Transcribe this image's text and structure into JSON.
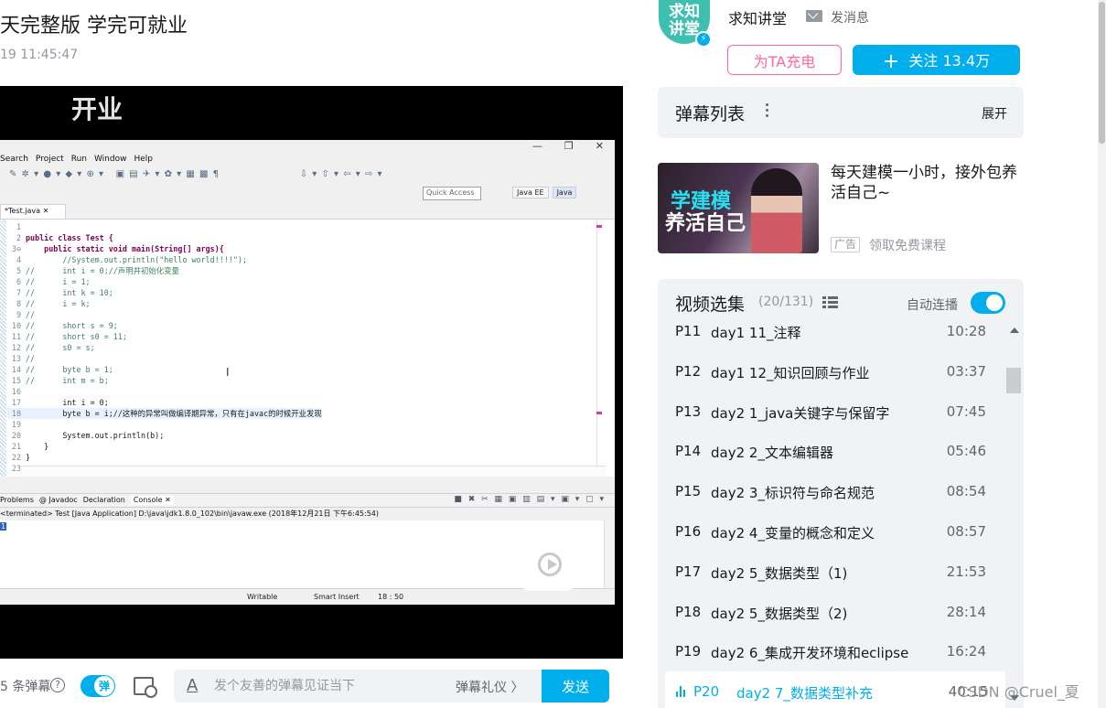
{
  "video": {
    "title": "天完整版 学完可就业",
    "date": "19 11:45:47",
    "caption": "开业"
  },
  "ide": {
    "window_buttons": [
      "—",
      "❐",
      "✕"
    ],
    "menus": [
      "Search",
      "Project",
      "Run",
      "Window",
      "Help"
    ],
    "quick_access": "Quick Access",
    "perspectives": [
      "Java EE",
      "Java"
    ],
    "editor_tab": "*Test.java ✕",
    "code": [
      {
        "n": "1",
        "t": "",
        "k": ""
      },
      {
        "n": "2",
        "t": "public class Test {",
        "k": "kw"
      },
      {
        "n": "3⊖",
        "t": "    public static void main(String[] args){",
        "k": "kw"
      },
      {
        "n": "4",
        "t": "        //System.out.println(\"hello world!!!!\");",
        "k": "cm"
      },
      {
        "n": "5",
        "t": "//      int i = 0;//声明并初始化变量",
        "k": "cm"
      },
      {
        "n": "6",
        "t": "//      i = 1;",
        "k": "cm"
      },
      {
        "n": "7",
        "t": "//      int k = 10;",
        "k": "cm"
      },
      {
        "n": "8",
        "t": "//      i = k;",
        "k": "cm"
      },
      {
        "n": "9",
        "t": "//",
        "k": "cm"
      },
      {
        "n": "10",
        "t": "//      short s = 9;",
        "k": "cm"
      },
      {
        "n": "11",
        "t": "//      short s0 = 11;",
        "k": "cm"
      },
      {
        "n": "12",
        "t": "//      s0 = s;",
        "k": "cm"
      },
      {
        "n": "13",
        "t": "//",
        "k": "cm"
      },
      {
        "n": "14",
        "t": "//      byte b = 1;",
        "k": "cm"
      },
      {
        "n": "15",
        "t": "//      int m = b;",
        "k": "cm"
      },
      {
        "n": "16",
        "t": "",
        "k": ""
      },
      {
        "n": "17",
        "t": "        int i = 0;",
        "k": ""
      },
      {
        "n": "18",
        "t": "        byte b = i;//这种的异常叫做编译期异常，只有在javac的时候开业发现",
        "k": "hl"
      },
      {
        "n": "19",
        "t": "",
        "k": ""
      },
      {
        "n": "20",
        "t": "        System.out.println(b);",
        "k": ""
      },
      {
        "n": "21",
        "t": "    }",
        "k": ""
      },
      {
        "n": "22",
        "t": "}",
        "k": ""
      },
      {
        "n": "23",
        "t": "",
        "k": ""
      }
    ],
    "console_tabs": [
      "Problems",
      "@ Javadoc",
      "Declaration",
      "Console ✕"
    ],
    "console_status": "<terminated> Test [Java Application] D:\\java\\jdk1.8.0_102\\bin\\javaw.exe (2018年12月21日 下午6:45:54)",
    "console_output": "1",
    "status_writable": "Writable",
    "status_insert": "Smart Insert",
    "status_position": "18 : 50"
  },
  "sendbar": {
    "count_label": "5 条弹幕",
    "toggle_label": "弹",
    "placeholder": "发个友善的弹幕见证当下",
    "etiquette": "弹幕礼仪 〉",
    "send_label": "发送"
  },
  "uploader": {
    "avatar_text": "求知\n讲堂",
    "name": "求知讲堂",
    "message_label": "发消息",
    "charge_label": "为TA充电",
    "follow_label": "关注 13.4万"
  },
  "danmaku_panel": {
    "title": "弹幕列表",
    "expand_label": "展开"
  },
  "ad": {
    "thumb_line1": "学建模",
    "thumb_line2": "养活自己",
    "title": "每天建模一小时，接外包养活自己~",
    "badge": "广告",
    "link": "领取免费课程"
  },
  "episodes": {
    "title": "视频选集",
    "count": "(20/131)",
    "autoplay_label": "自动连播",
    "items": [
      {
        "p": "P11",
        "title": "day1 11_注释",
        "duration": "10:28"
      },
      {
        "p": "P12",
        "title": "day1 12_知识回顾与作业",
        "duration": "03:37"
      },
      {
        "p": "P13",
        "title": "day2 1_java关键字与保留字",
        "duration": "07:45"
      },
      {
        "p": "P14",
        "title": "day2 2_文本编辑器",
        "duration": "05:46"
      },
      {
        "p": "P15",
        "title": "day2 3_标识符与命名规范",
        "duration": "08:54"
      },
      {
        "p": "P16",
        "title": "day2 4_变量的概念和定义",
        "duration": "08:57"
      },
      {
        "p": "P17",
        "title": "day2 5_数据类型（1)",
        "duration": "21:53"
      },
      {
        "p": "P18",
        "title": "day2 5_数据类型（2)",
        "duration": "28:14"
      },
      {
        "p": "P19",
        "title": "day2 6_集成开发环境和eclipse",
        "duration": "16:24"
      },
      {
        "p": "P20",
        "title": "day2 7_数据类型补充",
        "duration": "40:15",
        "current": true
      }
    ]
  },
  "watermark": "CSDN @Cruel_夏",
  "colors": {
    "accent": "#00aeec",
    "charge": "#ff6699",
    "panel_bg": "#f1f2f3"
  }
}
